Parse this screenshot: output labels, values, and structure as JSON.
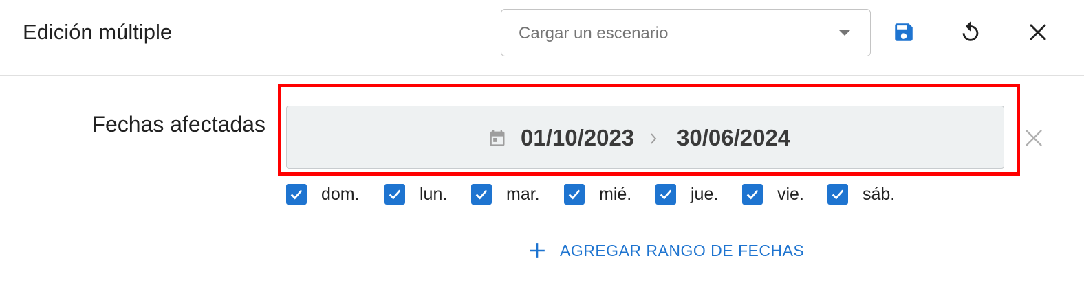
{
  "header": {
    "title": "Edición múltiple",
    "scenario_select": {
      "placeholder": "Cargar un escenario",
      "caret_icon": "arrow-drop-down-icon"
    },
    "actions": [
      {
        "name": "save",
        "icon": "save-icon"
      },
      {
        "name": "reset",
        "icon": "refresh-icon"
      },
      {
        "name": "close",
        "icon": "close-icon"
      }
    ]
  },
  "form": {
    "affected_dates_label": "Fechas afectadas",
    "date_range": {
      "start": "01/10/2023",
      "end": "30/06/2024",
      "icon": "calendar-icon",
      "separator_icon": "chevron-right-icon",
      "clear_icon": "close-icon"
    },
    "weekdays": [
      {
        "label": "dom.",
        "checked": true
      },
      {
        "label": "lun.",
        "checked": true
      },
      {
        "label": "mar.",
        "checked": true
      },
      {
        "label": "mié.",
        "checked": true
      },
      {
        "label": "jue.",
        "checked": true
      },
      {
        "label": "vie.",
        "checked": true
      },
      {
        "label": "sáb.",
        "checked": true
      }
    ],
    "add_range_label": "AGREGAR RANGO DE FECHAS",
    "add_range_icon": "plus-icon"
  },
  "colors": {
    "accent": "#1e74d0",
    "highlight": "#ff0000",
    "field_background": "#eef1f2"
  }
}
